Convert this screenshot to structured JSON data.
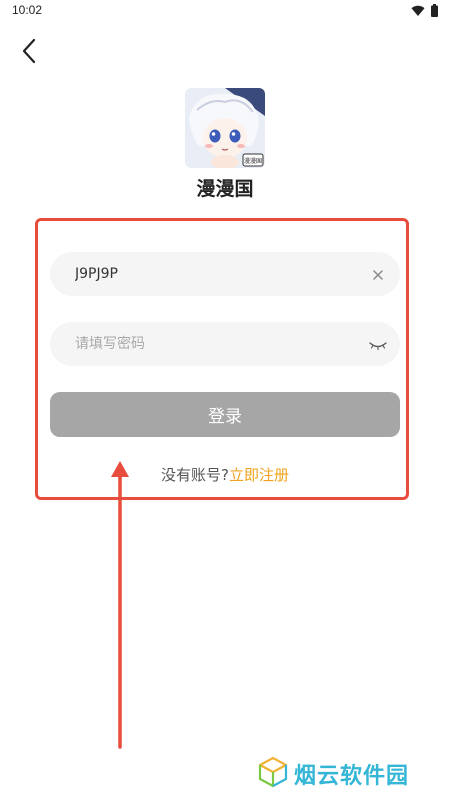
{
  "status_bar": {
    "time": "10:02",
    "icons": [
      "wifi-icon",
      "battery-icon"
    ]
  },
  "header": {
    "back_icon": "chevron-left-icon"
  },
  "app": {
    "name": "漫漫国",
    "logo_badge": "漫漫国"
  },
  "login_form": {
    "username_value": "J9PJ9P",
    "username_clear_icon": "close-icon",
    "password_placeholder": "请填写密码",
    "password_toggle_icon": "eye-closed-icon",
    "login_label": "登录",
    "register_prompt": "没有账号?",
    "register_link": "立即注册"
  },
  "annotation": {
    "frame_color": "#e74c3c",
    "arrow_color": "#e74c3c"
  },
  "watermark": {
    "text": "烟云软件园",
    "icon": "cube-logo-icon"
  },
  "colors": {
    "accent": "#f0a31c",
    "button_disabled": "#a6a6a6",
    "field_bg": "#f5f5f5"
  }
}
